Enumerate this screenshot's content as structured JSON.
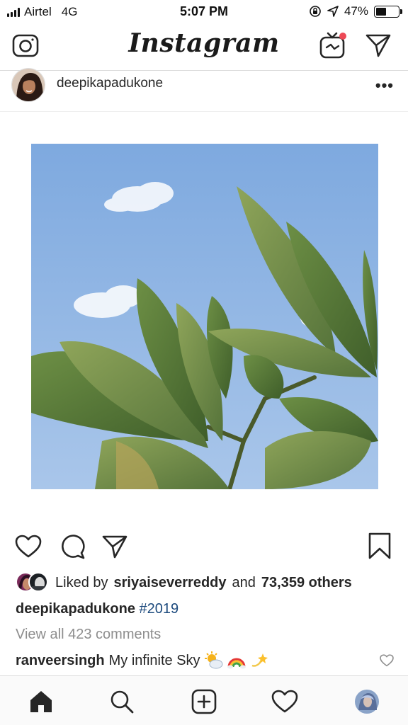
{
  "status_bar": {
    "carrier": "Airtel",
    "network": "4G",
    "time": "5:07 PM",
    "battery": "47%",
    "battery_level": 0.47
  },
  "top_nav": {
    "brand": "Instagram",
    "icons": [
      "camera-icon",
      "igtv-icon",
      "direct-message-icon"
    ]
  },
  "post": {
    "username": "deepikapadukone",
    "more_label": "•••",
    "photo_description_icon": "plant-photo",
    "likes": {
      "prefix": "Liked by",
      "liker": "sriyaiseverreddy",
      "joiner": "and",
      "others": "73,359 others"
    },
    "caption": {
      "username": "deepikapadukone",
      "hashtag": "#2019"
    },
    "view_comments": "View all 423 comments",
    "comment": {
      "username": "ranveersingh",
      "text": "My infinite Sky",
      "emojis": [
        "sun-behind-cloud",
        "rainbow",
        "dizzy"
      ]
    }
  },
  "bottom_nav": {
    "tabs": [
      "home",
      "search",
      "new-post",
      "activity",
      "profile"
    ]
  },
  "colors": {
    "hashtag": "#1c4a7d",
    "muted_text": "#8e8e8e",
    "notification_dot": "#ed4956"
  }
}
